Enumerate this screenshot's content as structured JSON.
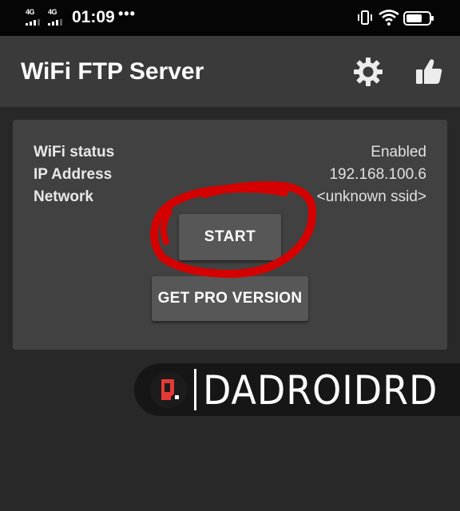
{
  "status_bar": {
    "signal_1": "4G",
    "signal_2": "4G",
    "time": "01:09",
    "overflow": "•••",
    "icons": [
      "vibrate-icon",
      "wifi-icon",
      "battery-icon"
    ]
  },
  "app_bar": {
    "title": "WiFi FTP Server",
    "actions": [
      "settings-gear-icon",
      "thumbs-up-icon"
    ]
  },
  "status_card": {
    "rows": [
      {
        "label": "WiFi status",
        "value": "Enabled"
      },
      {
        "label": "IP Address",
        "value": "192.168.100.6"
      },
      {
        "label": "Network",
        "value": "<unknown ssid>"
      }
    ],
    "start_label": "START",
    "pro_label": "GET PRO VERSION"
  },
  "annotation": {
    "type": "red-hand-drawn-circle",
    "color": "#d50000"
  },
  "watermark": {
    "text": "DADROIDRD",
    "logo_color": "#e53935"
  },
  "colors": {
    "background": "#282828",
    "app_bar": "#3a3a3a",
    "card": "#414141",
    "button": "#575757",
    "status_bar": "#050505"
  }
}
